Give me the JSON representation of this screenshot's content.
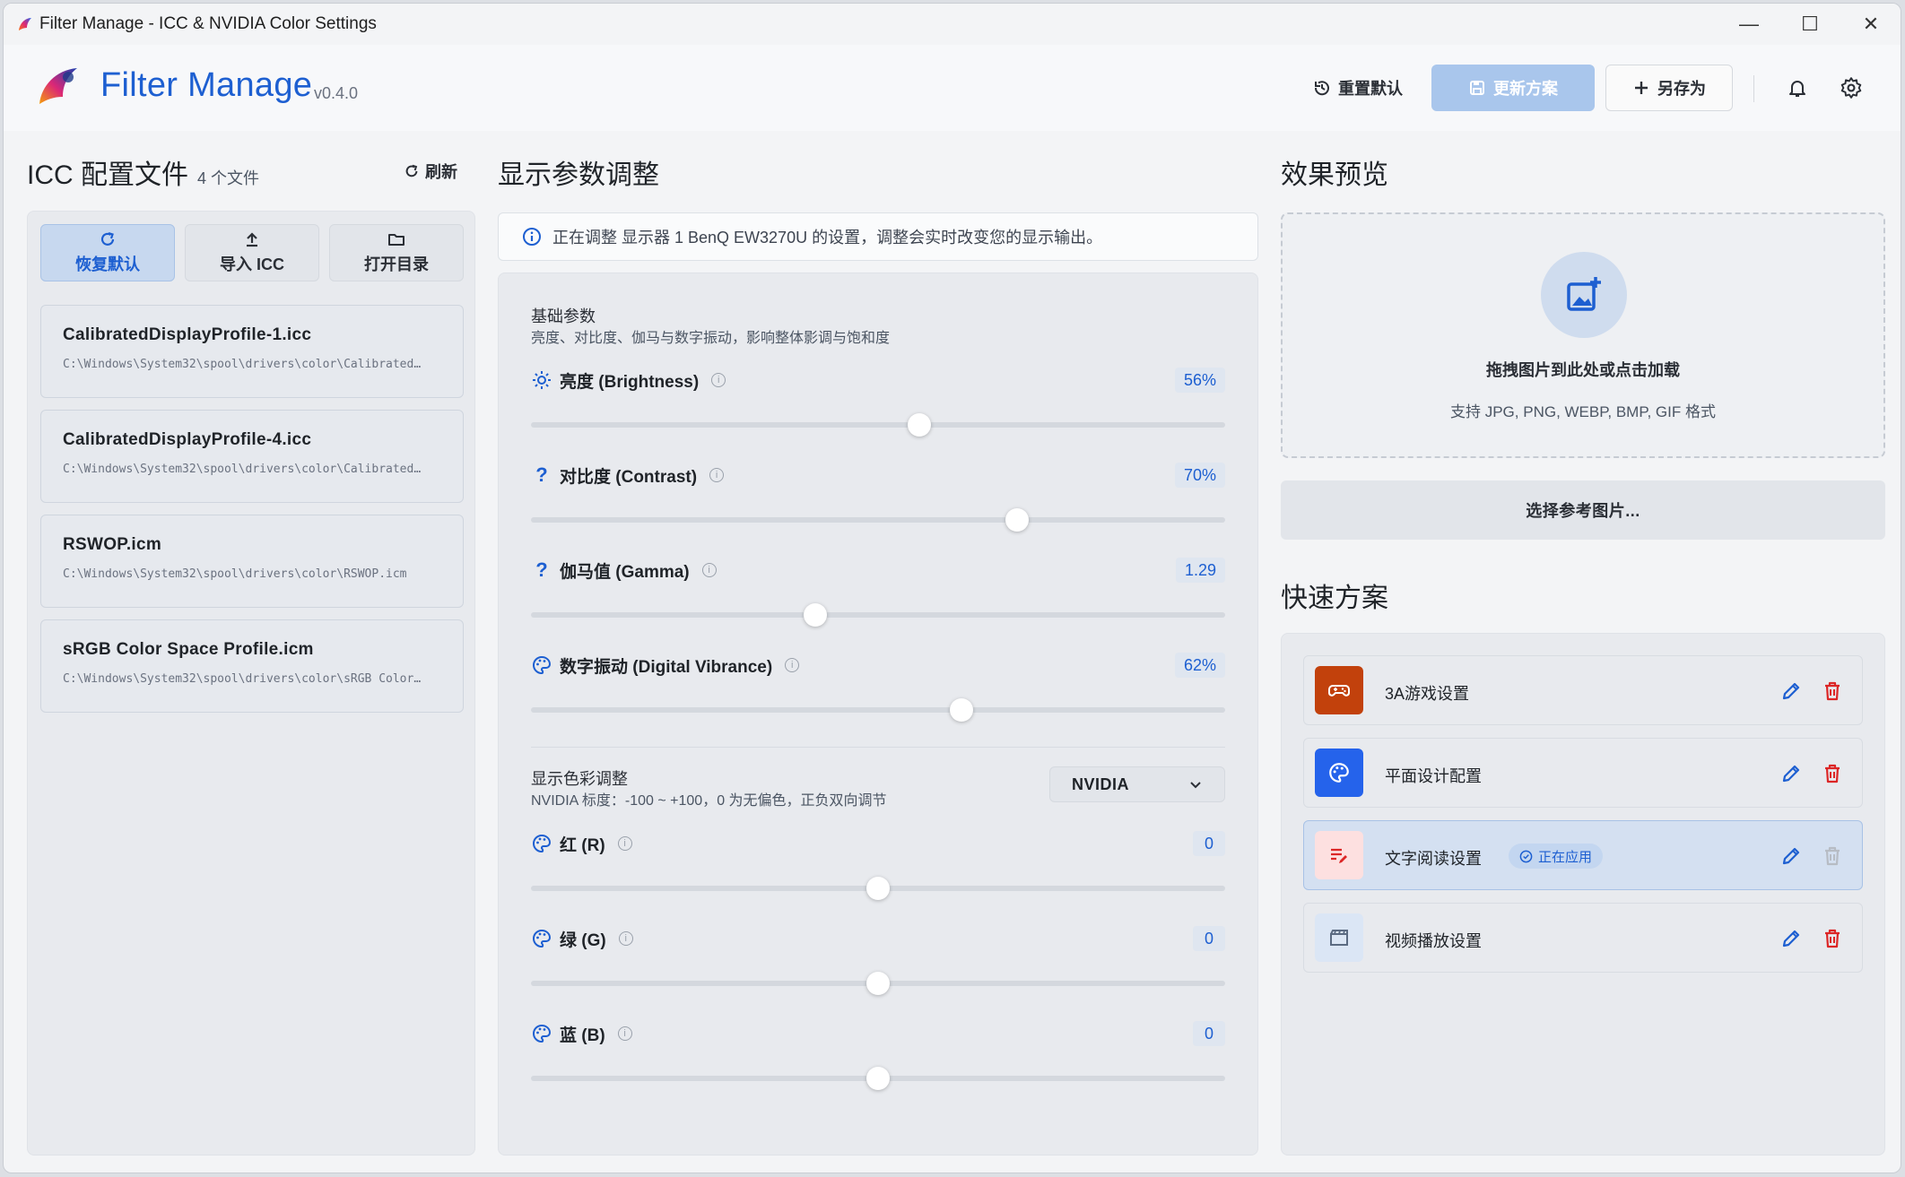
{
  "window": {
    "title": "Filter Manage - ICC & NVIDIA Color Settings",
    "minimize": "—",
    "maximize": "☐",
    "close": "✕"
  },
  "header": {
    "brand": "Filter Manage",
    "version": "v0.4.0",
    "reset_label": "重置默认",
    "update_label": "更新方案",
    "saveas_label": "另存为"
  },
  "icc_panel": {
    "title": "ICC 配置文件",
    "count": "4 个文件",
    "refresh_label": "刷新",
    "tools": [
      {
        "label": "恢复默认",
        "icon": "refresh-icon"
      },
      {
        "label": "导入 ICC",
        "icon": "upload-icon"
      },
      {
        "label": "打开目录",
        "icon": "folder-icon"
      }
    ],
    "profiles": [
      {
        "name": "CalibratedDisplayProfile-1.icc",
        "path": "C:\\Windows\\System32\\spool\\drivers\\color\\Calibrated…"
      },
      {
        "name": "CalibratedDisplayProfile-4.icc",
        "path": "C:\\Windows\\System32\\spool\\drivers\\color\\Calibrated…"
      },
      {
        "name": "RSWOP.icm",
        "path": "C:\\Windows\\System32\\spool\\drivers\\color\\RSWOP.icm"
      },
      {
        "name": "sRGB Color Space Profile.icm",
        "path": "C:\\Windows\\System32\\spool\\drivers\\color\\sRGB Color…"
      }
    ]
  },
  "display_panel": {
    "title": "显示参数调整",
    "info": "正在调整 显示器 1 BenQ EW3270U 的设置，调整会实时改变您的显示输出。",
    "basic": {
      "title": "基础参数",
      "desc": "亮度、对比度、伽马与数字振动，影响整体影调与饱和度",
      "params": [
        {
          "label": "亮度 (Brightness)",
          "value": "56%",
          "fraction": 0.56,
          "icon": "sun-icon"
        },
        {
          "label": "对比度 (Contrast)",
          "value": "70%",
          "fraction": 0.7,
          "icon": "question-icon"
        },
        {
          "label": "伽马值 (Gamma)",
          "value": "1.29",
          "fraction": 0.41,
          "icon": "question-icon"
        },
        {
          "label": "数字振动 (Digital Vibrance)",
          "value": "62%",
          "fraction": 0.62,
          "icon": "palette-icon"
        }
      ]
    },
    "color": {
      "title": "显示色彩调整",
      "desc": "NVIDIA 标度：-100 ~ +100，0 为无偏色，正负双向调节",
      "select_value": "NVIDIA",
      "params": [
        {
          "label": "红 (R)",
          "value": "0",
          "fraction": 0.5,
          "icon": "palette-icon"
        },
        {
          "label": "绿 (G)",
          "value": "0",
          "fraction": 0.5,
          "icon": "palette-icon"
        },
        {
          "label": "蓝 (B)",
          "value": "0",
          "fraction": 0.5,
          "icon": "palette-icon"
        }
      ]
    }
  },
  "preview_panel": {
    "title": "效果预览",
    "drop_title": "拖拽图片到此处或点击加载",
    "drop_sub": "支持 JPG, PNG, WEBP, BMP, GIF 格式",
    "choose_label": "选择参考图片..."
  },
  "presets_panel": {
    "title": "快速方案",
    "active_badge": "正在应用",
    "items": [
      {
        "name": "3A游戏设置",
        "icon": "gamepad-icon",
        "color": "#c2410c",
        "active": false
      },
      {
        "name": "平面设计配置",
        "icon": "palette-icon",
        "color": "#2563eb",
        "active": false
      },
      {
        "name": "文字阅读设置",
        "icon": "edit-note-icon",
        "color": "#fde0e0",
        "active": true
      },
      {
        "name": "视频播放设置",
        "icon": "clapperboard-icon",
        "color": "#dbe6f5",
        "active": false
      }
    ]
  },
  "colors": {
    "accent": "#1d5fd1",
    "danger": "#dc2626"
  }
}
